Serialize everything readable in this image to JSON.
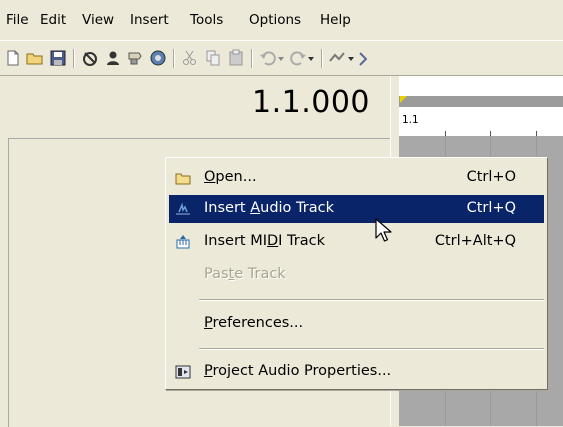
{
  "menubar": {
    "items": [
      "File",
      "Edit",
      "View",
      "Insert",
      "Tools",
      "Options",
      "Help"
    ]
  },
  "toolbar": {
    "icons": [
      "new-file-icon",
      "open-folder-icon",
      "save-icon",
      "record-icon",
      "user-icon",
      "plugin-icon",
      "audio-properties-icon",
      "cut-icon",
      "copy-icon",
      "paste-icon",
      "undo-icon",
      "redo-icon",
      "snap-icon",
      "tool-icon"
    ]
  },
  "transport": {
    "time": "1.1.000"
  },
  "ruler": {
    "label": "1.1"
  },
  "context_menu": {
    "items": [
      {
        "label_pre": "",
        "label_mnemonic": "O",
        "label_post": "pen...",
        "shortcut": "Ctrl+O",
        "icon": "folder-icon"
      },
      {
        "label_pre": "Insert ",
        "label_mnemonic": "A",
        "label_post": "udio Track",
        "shortcut": "Ctrl+Q",
        "icon": "audio-track-icon"
      },
      {
        "label_pre": "Insert MI",
        "label_mnemonic": "D",
        "label_post": "I Track",
        "shortcut": "Ctrl+Alt+Q",
        "icon": "midi-track-icon"
      },
      {
        "label_pre": "Pas",
        "label_mnemonic": "t",
        "label_post": "e Track",
        "shortcut": "",
        "icon": ""
      },
      {
        "label_pre": "",
        "label_mnemonic": "P",
        "label_post": "references...",
        "shortcut": "",
        "icon": ""
      },
      {
        "label_pre": "",
        "label_mnemonic": "P",
        "label_post": "roject Audio Properties...",
        "shortcut": "",
        "icon": "project-properties-icon"
      }
    ]
  },
  "colors": {
    "menu_highlight": "#0a246a",
    "chrome": "#ece9d8",
    "arrange_bg": "#a8a8a8",
    "ruler_marker": "#e8d200"
  }
}
